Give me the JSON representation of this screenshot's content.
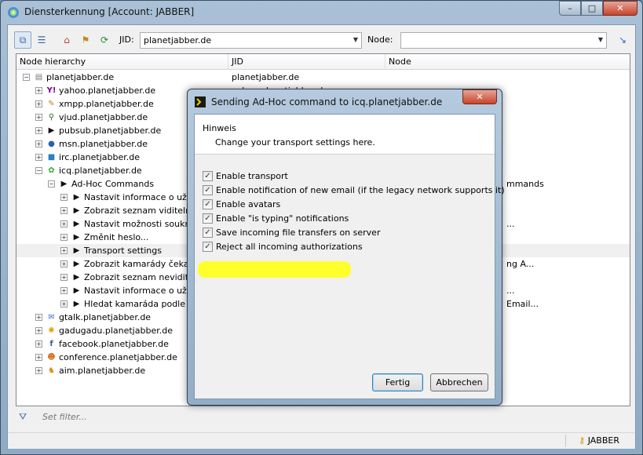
{
  "window": {
    "title": "Diensterkennung [Account: JABBER]",
    "min": "–",
    "max": "□",
    "close": "✕"
  },
  "toolbar": {
    "jid_label": "JID:",
    "jid_value": "planetjabber.de",
    "node_label": "Node:",
    "node_value": ""
  },
  "columns": [
    "Node hierarchy",
    "JID",
    "Node"
  ],
  "tree": [
    {
      "indent": 0,
      "exp": "−",
      "icon": "server-icon",
      "glyph": "▤",
      "color": "#777",
      "name": "planetjabber.de",
      "jid": "planetjabber.de",
      "node": ""
    },
    {
      "indent": 1,
      "exp": "+",
      "icon": "yahoo-icon",
      "glyph": "Y!",
      "color": "#7b0099",
      "name": "yahoo.planetjabber.de",
      "jid": "yahoo.planetjabber.de",
      "node": ""
    },
    {
      "indent": 1,
      "exp": "+",
      "icon": "xmpp-icon",
      "glyph": "✎",
      "color": "#c47a1d",
      "name": "xmpp.planetjabber.de",
      "jid": "",
      "node": ""
    },
    {
      "indent": 1,
      "exp": "+",
      "icon": "search-user-icon",
      "glyph": "⚲",
      "color": "#2d6a2d",
      "name": "vjud.planetjabber.de",
      "jid": "",
      "node": ""
    },
    {
      "indent": 1,
      "exp": "+",
      "icon": "terminal-icon",
      "glyph": "▶",
      "color": "#111",
      "name": "pubsub.planetjabber.de",
      "jid": "",
      "node": ""
    },
    {
      "indent": 1,
      "exp": "+",
      "icon": "msn-icon",
      "glyph": "●",
      "color": "#2a5fb0",
      "name": "msn.planetjabber.de",
      "jid": "",
      "node": ""
    },
    {
      "indent": 1,
      "exp": "+",
      "icon": "irc-icon",
      "glyph": "■",
      "color": "#2a7fc0",
      "name": "irc.planetjabber.de",
      "jid": "",
      "node": ""
    },
    {
      "indent": 1,
      "exp": "−",
      "icon": "icq-flower-icon",
      "glyph": "✿",
      "color": "#3aa63a",
      "name": "icq.planetjabber.de",
      "jid": "",
      "node": ""
    },
    {
      "indent": 2,
      "exp": "−",
      "icon": "terminal-icon",
      "glyph": "▶",
      "color": "#111",
      "name": "Ad-Hoc Commands",
      "jid": "",
      "node": "mmands"
    },
    {
      "indent": 3,
      "exp": "+",
      "icon": "terminal-icon",
      "glyph": "▶",
      "color": "#111",
      "name": "Nastavit informace o uživat",
      "jid": "",
      "node": ""
    },
    {
      "indent": 3,
      "exp": "+",
      "icon": "terminal-icon",
      "glyph": "▶",
      "color": "#111",
      "name": "Zobrazit seznam viditelných",
      "jid": "",
      "node": ""
    },
    {
      "indent": 3,
      "exp": "+",
      "icon": "terminal-icon",
      "glyph": "▶",
      "color": "#111",
      "name": "Nastavit možnosti soukromí",
      "jid": "",
      "node": "..."
    },
    {
      "indent": 3,
      "exp": "+",
      "icon": "terminal-icon",
      "glyph": "▶",
      "color": "#111",
      "name": "Změnit heslo...",
      "jid": "",
      "node": ""
    },
    {
      "indent": 3,
      "exp": "+",
      "icon": "terminal-icon",
      "glyph": "▶",
      "color": "#111",
      "name": "Transport settings",
      "jid": "",
      "node": "",
      "selected": true
    },
    {
      "indent": 3,
      "exp": "+",
      "icon": "terminal-icon",
      "glyph": "▶",
      "color": "#111",
      "name": "Zobrazit kamarády čekající n",
      "jid": "",
      "node": "ng A..."
    },
    {
      "indent": 3,
      "exp": "+",
      "icon": "terminal-icon",
      "glyph": "▶",
      "color": "#111",
      "name": "Zobrazit seznam neviditelný",
      "jid": "",
      "node": ""
    },
    {
      "indent": 3,
      "exp": "+",
      "icon": "terminal-icon",
      "glyph": "▶",
      "color": "#111",
      "name": "Nastavit informace o uživat",
      "jid": "",
      "node": "..."
    },
    {
      "indent": 3,
      "exp": "+",
      "icon": "terminal-icon",
      "glyph": "▶",
      "color": "#111",
      "name": "Hledat kamaráda podle ema",
      "jid": "",
      "node": "Email..."
    },
    {
      "indent": 1,
      "exp": "+",
      "icon": "gtalk-icon",
      "glyph": "✉",
      "color": "#3c78c8",
      "name": "gtalk.planetjabber.de",
      "jid": "",
      "node": ""
    },
    {
      "indent": 1,
      "exp": "+",
      "icon": "gadugadu-icon",
      "glyph": "✺",
      "color": "#e0a000",
      "name": "gadugadu.planetjabber.de",
      "jid": "",
      "node": ""
    },
    {
      "indent": 1,
      "exp": "+",
      "icon": "facebook-icon",
      "glyph": "f",
      "color": "#3b5998",
      "name": "facebook.planetjabber.de",
      "jid": "",
      "node": ""
    },
    {
      "indent": 1,
      "exp": "+",
      "icon": "conference-icon",
      "glyph": "☻",
      "color": "#d06a1a",
      "name": "conference.planetjabber.de",
      "jid": "",
      "node": ""
    },
    {
      "indent": 1,
      "exp": "+",
      "icon": "aim-icon",
      "glyph": "♞",
      "color": "#e08a00",
      "name": "aim.planetjabber.de",
      "jid": "",
      "node": ""
    }
  ],
  "filter": {
    "placeholder": "Set filter..."
  },
  "status": {
    "account": "JABBER"
  },
  "dialog": {
    "title": "Sending Ad-Hoc command to icq.planetjabber.de",
    "close": "✕",
    "hint_title": "Hinweis",
    "hint_text": "Change your transport settings here.",
    "options": [
      {
        "label": "Enable transport",
        "checked": true
      },
      {
        "label": "Enable notification of new email (if the legacy network supports it)",
        "checked": true
      },
      {
        "label": "Enable avatars",
        "checked": true
      },
      {
        "label": "Enable \"is typing\" notifications",
        "checked": true
      },
      {
        "label": "Save incoming file transfers on server",
        "checked": true
      },
      {
        "label": "Reject all incoming authorizations",
        "checked": true
      }
    ],
    "ok_label": "Fertig",
    "cancel_label": "Abbrechen"
  },
  "colors": {
    "highlight": "#ffff2b",
    "titlebar": "#a9c0d6"
  }
}
